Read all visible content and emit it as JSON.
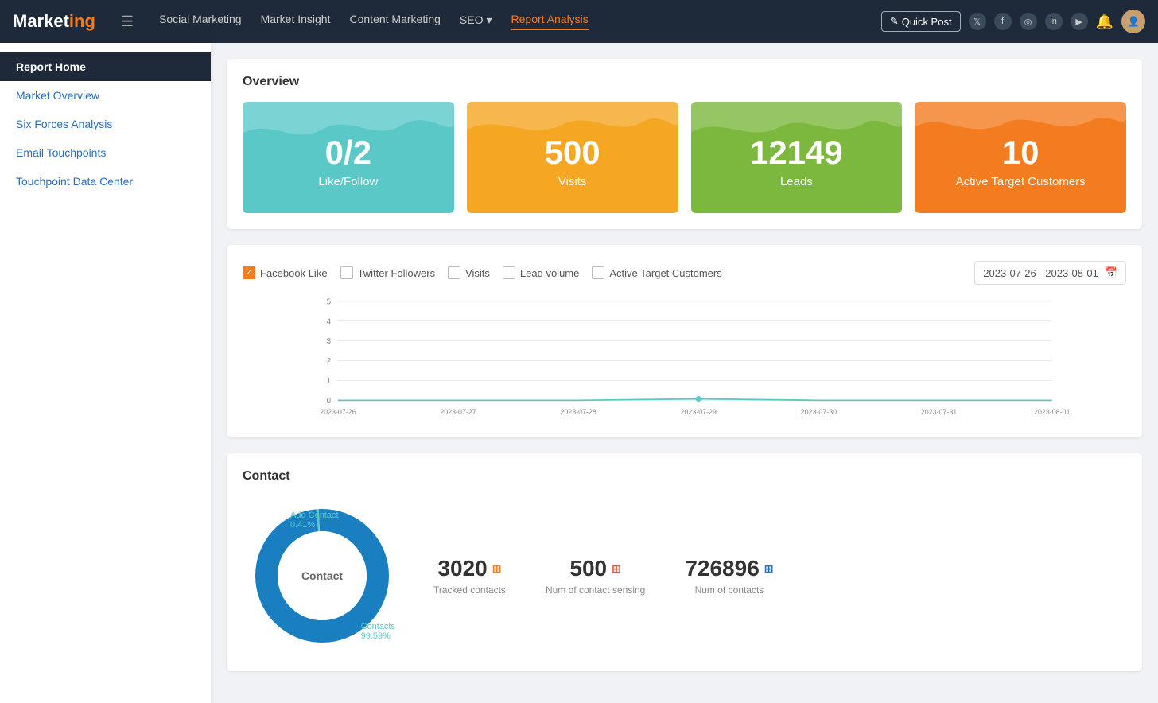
{
  "app": {
    "logo_text": "Market",
    "logo_highlight": "ing",
    "hamburger": "☰"
  },
  "nav": {
    "links": [
      {
        "label": "Social Marketing",
        "active": false
      },
      {
        "label": "Market Insight",
        "active": false
      },
      {
        "label": "Content Marketing",
        "active": false
      },
      {
        "label": "SEO",
        "active": false,
        "has_dropdown": true
      },
      {
        "label": "Report Analysis",
        "active": true
      }
    ],
    "quick_post": "Quick Post",
    "social_icons": [
      "t",
      "f",
      "i",
      "in",
      "yt"
    ],
    "bell": "🔔"
  },
  "sidebar": {
    "items": [
      {
        "label": "Report Home",
        "active": true
      },
      {
        "label": "Market Overview",
        "active": false
      },
      {
        "label": "Six Forces Analysis",
        "active": false
      },
      {
        "label": "Email Touchpoints",
        "active": false
      },
      {
        "label": "Touchpoint Data Center",
        "active": false
      }
    ]
  },
  "overview": {
    "title": "Overview",
    "cards": [
      {
        "number": "0/2",
        "label": "Like/Follow",
        "color": "teal"
      },
      {
        "number": "500",
        "label": "Visits",
        "color": "yellow"
      },
      {
        "number": "12149",
        "label": "Leads",
        "color": "green"
      },
      {
        "number": "10",
        "label": "Active Target Customers",
        "color": "orange"
      }
    ]
  },
  "chart": {
    "filters": [
      {
        "label": "Facebook Like",
        "checked": true
      },
      {
        "label": "Twitter Followers",
        "checked": false
      },
      {
        "label": "Visits",
        "checked": false
      },
      {
        "label": "Lead volume",
        "checked": false
      },
      {
        "label": "Active Target Customers",
        "checked": false
      }
    ],
    "date_range": "2023-07-26 - 2023-08-01",
    "y_labels": [
      "5",
      "4",
      "3",
      "2",
      "1",
      "0"
    ],
    "x_labels": [
      "2023-07-26",
      "2023-07-27",
      "2023-07-28",
      "2023-07-29",
      "2023-07-30",
      "2023-07-31",
      "2023-08-01"
    ]
  },
  "contact": {
    "title": "Contact",
    "donut_label": "Contact",
    "segments": [
      {
        "label": "Add Contact",
        "pct": "0.41%",
        "color": "#5bc8c8",
        "small": true
      },
      {
        "label": "Contacts",
        "pct": "99.59%",
        "color": "#1a7fc1",
        "large": true
      }
    ],
    "stats": [
      {
        "number": "3020",
        "label": "Tracked contacts",
        "icon_color": "orange"
      },
      {
        "number": "500",
        "label": "Num of contact sensing",
        "icon_color": "red"
      },
      {
        "number": "726896",
        "label": "Num of contacts",
        "icon_color": "blue"
      }
    ]
  }
}
